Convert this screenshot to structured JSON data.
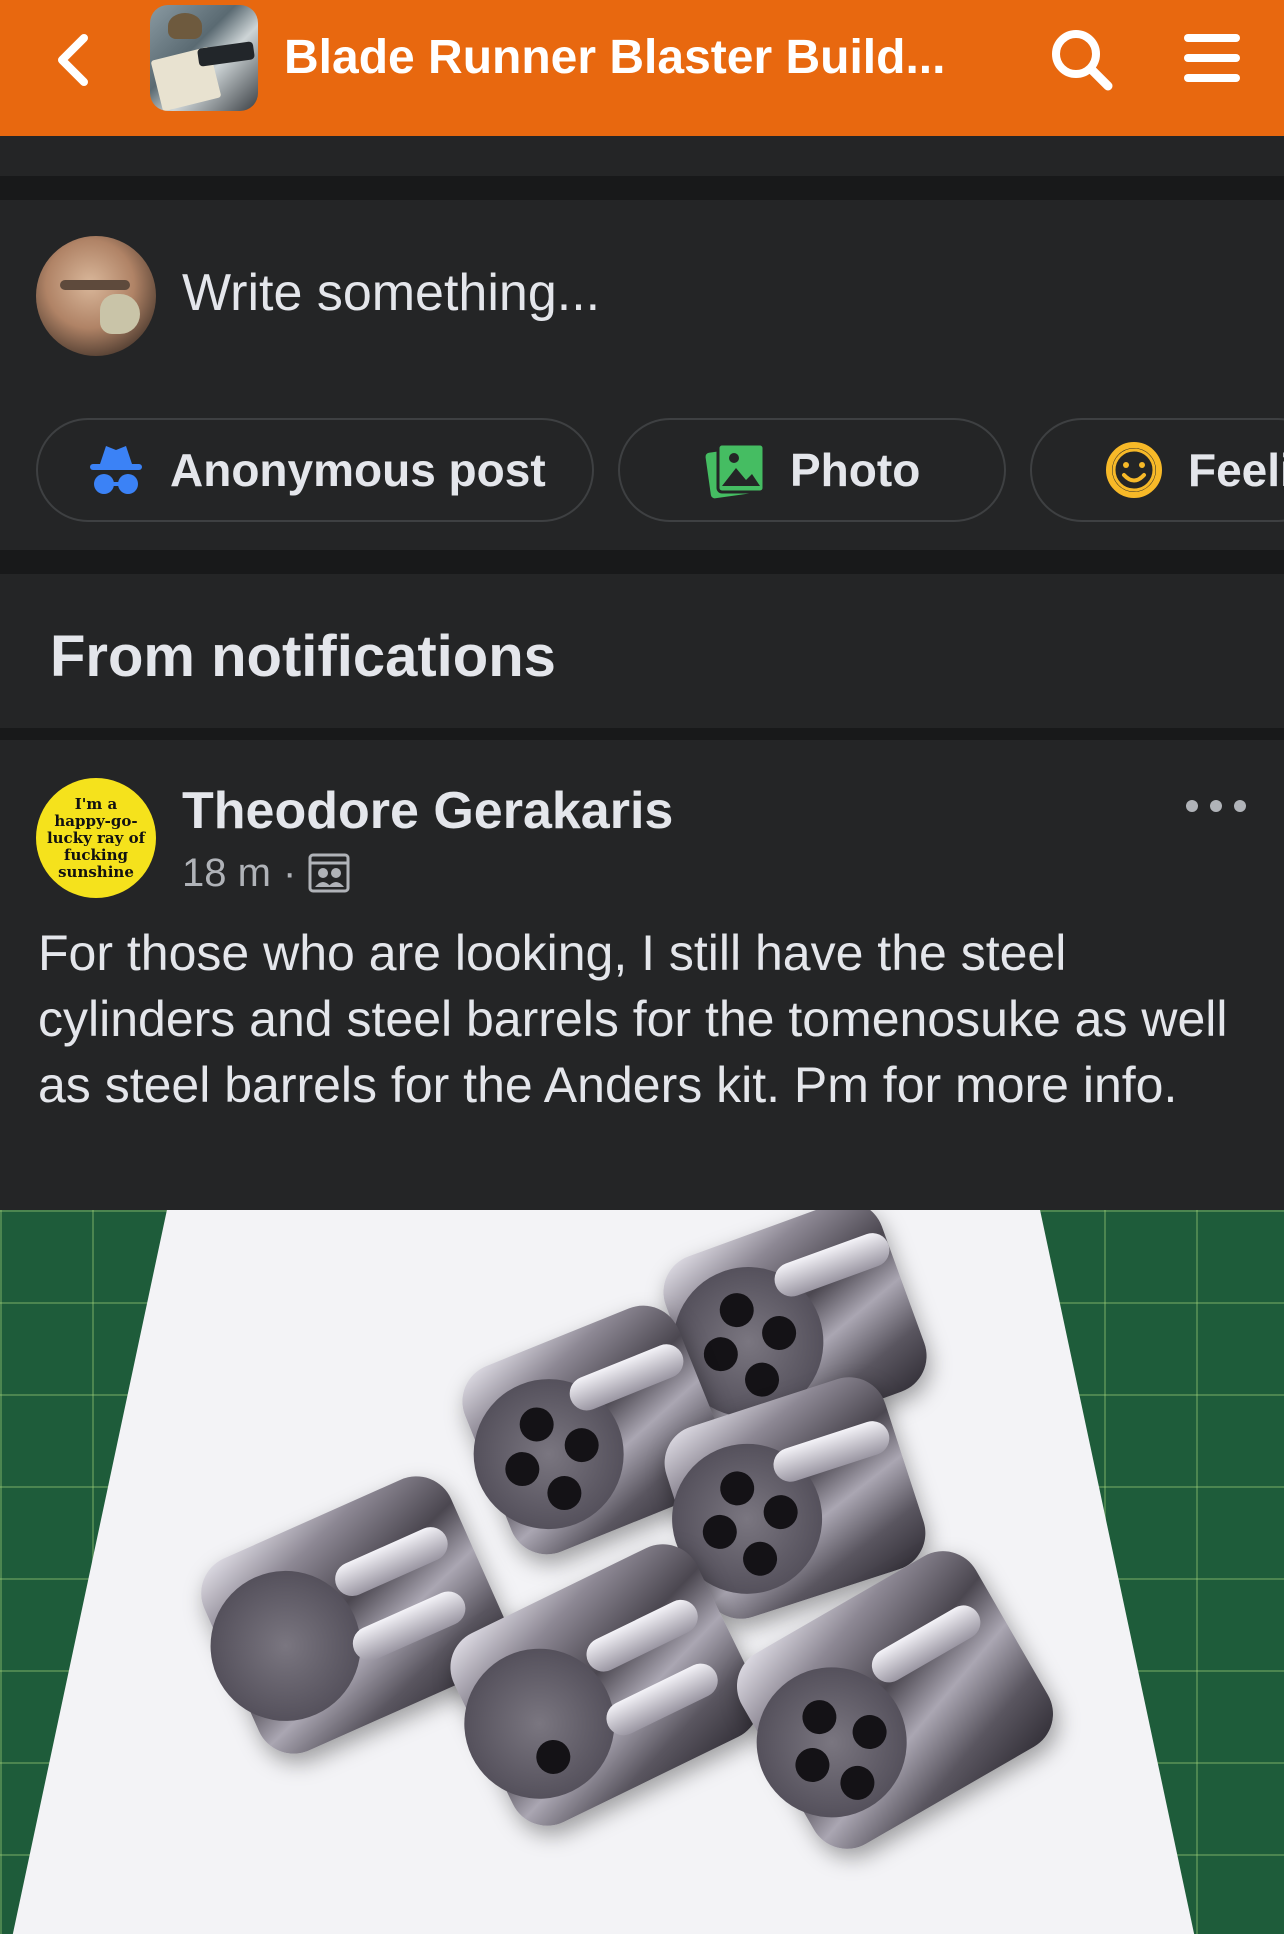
{
  "header": {
    "title": "Blade Runner Blaster Build...",
    "bg_color": "#e8680f"
  },
  "composer": {
    "placeholder": "Write something..."
  },
  "actions": {
    "anonymous_label": "Anonymous post",
    "photo_label": "Photo",
    "feeling_label": "Feeli"
  },
  "section": {
    "title": "From notifications"
  },
  "post": {
    "author": "Theodore Gerakaris",
    "avatar_text": "I'm a happy-go-lucky ray of fucking sunshine",
    "time": "18 m",
    "dot": "·",
    "text": "For those who are looking, I still have the steel cylinders and steel barrels for the tomenosuke as well as steel barrels for the Anders kit. Pm for more info."
  },
  "icons": {
    "back": "chevron-left-icon",
    "search": "search-icon",
    "menu": "hamburger-menu-icon",
    "anonymous": "incognito-icon",
    "photo": "photo-icon",
    "feeling": "smiley-icon",
    "audience": "group-audience-icon",
    "more": "more-dots-icon"
  }
}
